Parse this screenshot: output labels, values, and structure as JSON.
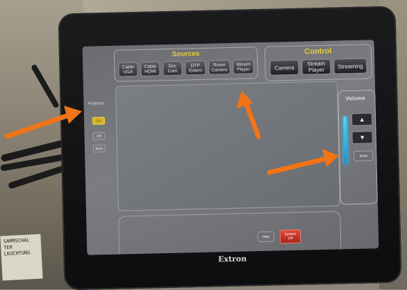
{
  "sources": {
    "title": "Sources",
    "buttons": [
      {
        "line1": "Cable",
        "line2": "VGA"
      },
      {
        "line1": "Cable",
        "line2": "HDMI"
      },
      {
        "line1": "Doc",
        "line2": "Cam"
      },
      {
        "line1": "DTP",
        "line2": "Extern"
      },
      {
        "line1": "Room",
        "line2": "Camera"
      },
      {
        "line1": "Stream",
        "line2": "Player"
      }
    ]
  },
  "control": {
    "title": "Control",
    "buttons": [
      {
        "line1": "Camera",
        "line2": ""
      },
      {
        "line1": "Stream",
        "line2": "Player"
      },
      {
        "line1": "Streaming",
        "line2": ""
      }
    ]
  },
  "projector": {
    "label": "Projector",
    "buttons": [
      "On",
      "Off",
      "Mute"
    ]
  },
  "volume": {
    "label": "Volume",
    "up_glyph": "▲",
    "down_glyph": "▼",
    "mute_label": "Mute",
    "level": 0.55
  },
  "footer": {
    "help_label": "Help",
    "system_off_line1": "System",
    "system_off_line2": "Off"
  },
  "brand": "Extron",
  "sticker_text": "SAMMSCHAL TER LEUCHTUNG",
  "colors": {
    "accent_yellow": "#e6d03a",
    "arrow_orange": "#f07418",
    "volume_blue": "#3bc8ff",
    "system_off_red": "#d83a2e"
  }
}
